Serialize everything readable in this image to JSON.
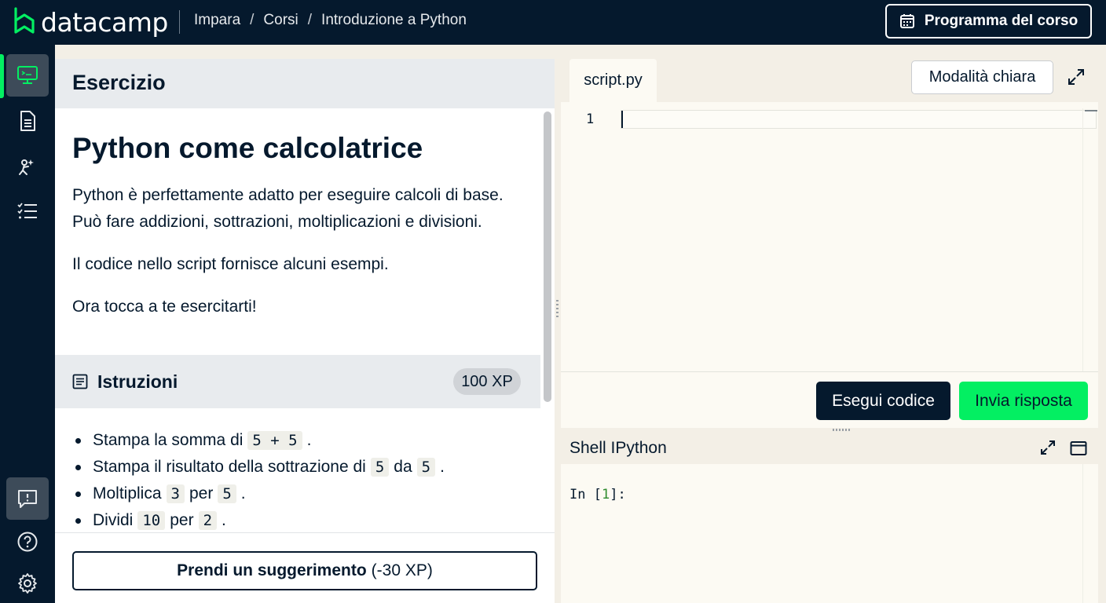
{
  "header": {
    "logo_text": "datacamp",
    "breadcrumb": [
      "Impara",
      "Corsi",
      "Introduzione a Python"
    ],
    "breadcrumb_separator": "/",
    "program_button": "Programma del corso"
  },
  "sidebar": {
    "items": [
      {
        "icon": "exercise-screen-icon",
        "active": true
      },
      {
        "icon": "slides-document-icon",
        "active": false
      },
      {
        "icon": "ai-assistant-icon",
        "active": false
      },
      {
        "icon": "course-outline-icon",
        "active": false
      }
    ],
    "bottom_items": [
      {
        "icon": "feedback-chat-icon"
      },
      {
        "icon": "help-icon"
      },
      {
        "icon": "settings-gear-icon"
      }
    ]
  },
  "exercise": {
    "section_label": "Esercizio",
    "title": "Python come calcolatrice",
    "paragraphs": [
      "Python è perfettamente adatto per eseguire calcoli di base. Può fare addizioni, sottrazioni, moltiplicazioni e divisioni.",
      "Il codice nello script fornisce alcuni esempi.",
      "Ora tocca a te esercitarti!"
    ]
  },
  "instructions": {
    "label": "Istruzioni",
    "xp": "100 XP",
    "items": [
      {
        "pre": "Stampa la somma di",
        "code1": "5 + 5",
        "mid": "",
        "code2": "",
        "post": "."
      },
      {
        "pre": "Stampa il risultato della sottrazione di",
        "code1": "5",
        "mid": "da",
        "code2": "5",
        "post": "."
      },
      {
        "pre": "Moltiplica",
        "code1": "3",
        "mid": "per",
        "code2": "5",
        "post": "."
      },
      {
        "pre": "Dividi",
        "code1": "10",
        "mid": "per",
        "code2": "2",
        "post": "."
      }
    ]
  },
  "hint": {
    "bold": "Prendi un suggerimento",
    "suffix": "(-30 XP)"
  },
  "editor": {
    "tab": "script.py",
    "theme_button": "Modalità chiara",
    "line_numbers": [
      "1"
    ],
    "run_button": "Esegui codice",
    "submit_button": "Invia risposta"
  },
  "shell": {
    "title": "Shell IPython",
    "prompt_prefix": "In [",
    "prompt_number": "1",
    "prompt_suffix": "]:"
  },
  "colors": {
    "navy": "#05192d",
    "accent_green": "#03ef62",
    "background": "#f3efe6"
  }
}
